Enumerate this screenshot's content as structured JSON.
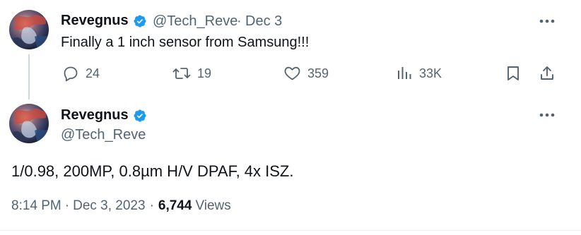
{
  "reply_tweet": {
    "display_name": "Revegnus",
    "handle": "@Tech_Reve",
    "separator": "·",
    "date": "Dec 3",
    "text": "Finally a 1 inch sensor from Samsung!!!",
    "actions": {
      "replies": "24",
      "retweets": "19",
      "likes": "359",
      "views": "33K"
    }
  },
  "main_tweet": {
    "display_name": "Revegnus",
    "handle": "@Tech_Reve",
    "text": "1/0.98, 200MP, 0.8µm H/V DPAF, 4x ISZ.",
    "time": "8:14 PM",
    "separator": "·",
    "date": "Dec 3, 2023",
    "separator2": "·",
    "view_count": "6,744",
    "views_label": "Views"
  },
  "icons": {
    "verified": "verified-badge-icon",
    "more": "more-horizontal-icon",
    "reply": "reply-icon",
    "retweet": "retweet-icon",
    "like": "heart-icon",
    "views": "views-bar-chart-icon",
    "bookmark": "bookmark-icon",
    "share": "share-icon"
  },
  "colors": {
    "text_primary": "#0f1419",
    "text_secondary": "#536471",
    "verified_blue": "#1d9bf0",
    "thread_line": "#cfd9de"
  }
}
